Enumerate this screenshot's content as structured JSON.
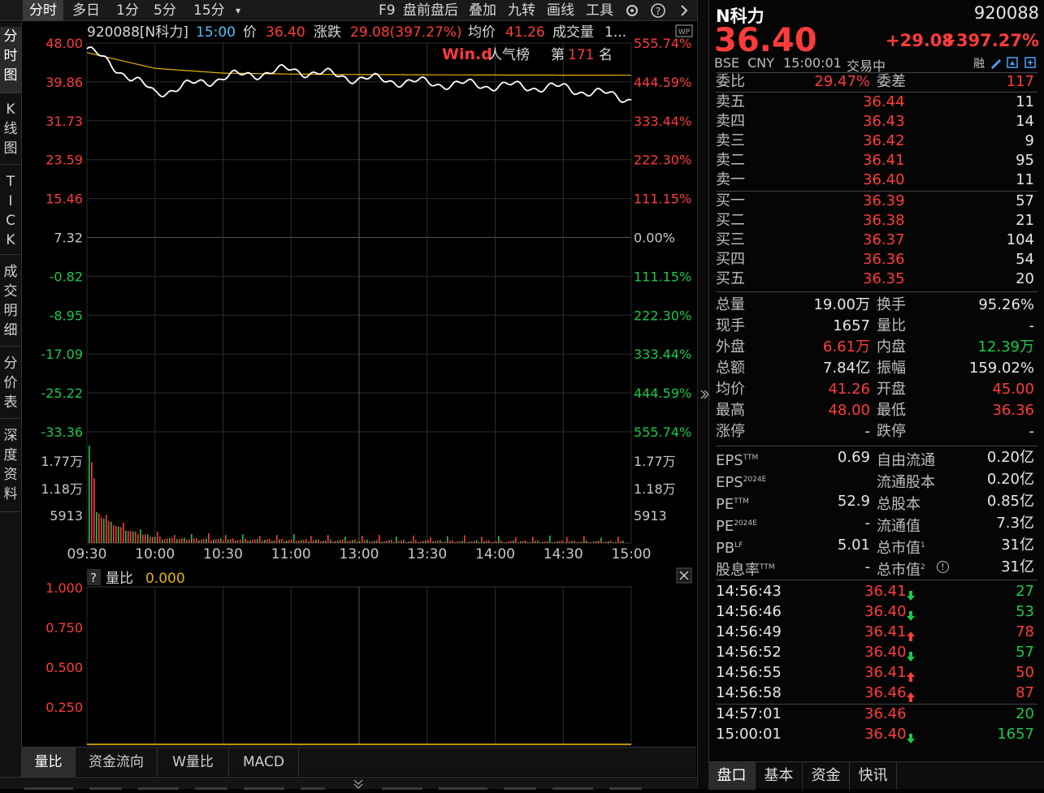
{
  "toolbar": {
    "tabs": [
      "分时",
      "多日",
      "1分",
      "5分",
      "15分"
    ],
    "dropdown": "▾",
    "actions": [
      "F9",
      "盘前盘后",
      "叠加",
      "九转",
      "画线",
      "工具"
    ]
  },
  "left_tabs": [
    {
      "label": "分\n时\n图"
    },
    {
      "label": "K\n线\n图"
    },
    {
      "label": "T\nI\nC\nK"
    },
    {
      "label": "成\n交\n明\n细"
    },
    {
      "label": "分\n价\n表"
    },
    {
      "label": "深\n度\n资\n料"
    }
  ],
  "chart_header": {
    "code_name": "920088[N科力]",
    "time": "15:00",
    "price_label": "价",
    "price": "36.40",
    "change_label": "涨跌",
    "change": "29.08(397.27%)",
    "avg_label": "均价",
    "avg": "41.26",
    "vol_label": "成交量",
    "vol": "1...",
    "wp_badge": "WP"
  },
  "popularity": {
    "logo": "Win.d",
    "label": "人气榜",
    "rank_prefix": "第",
    "rank": "171",
    "rank_suffix": "名"
  },
  "price_axis": {
    "left": [
      "48.00",
      "39.86",
      "31.73",
      "23.59",
      "15.46",
      "7.32",
      "-0.82",
      "-8.95",
      "-17.09",
      "-25.22",
      "-33.36"
    ],
    "right": [
      "555.74%",
      "444.59%",
      "333.44%",
      "222.30%",
      "111.15%",
      "0.00%",
      "111.15%",
      "222.30%",
      "333.44%",
      "444.59%",
      "555.74%"
    ]
  },
  "volume_axis": {
    "left": [
      "1.77万",
      "1.18万",
      "5913"
    ],
    "right": [
      "1.77万",
      "1.18万",
      "5913"
    ]
  },
  "time_axis": [
    "09:30",
    "10:00",
    "10:30",
    "11:00",
    "13:00",
    "13:30",
    "14:00",
    "14:30",
    "15:00"
  ],
  "indicator": {
    "help": "?",
    "name": "量比",
    "value": "0.000",
    "axis": [
      "1.000",
      "0.750",
      "0.500",
      "0.250"
    ]
  },
  "bottom_tabs": [
    "量比",
    "资金流向",
    "W量比",
    "MACD"
  ],
  "chart_data": {
    "type": "line",
    "title": "",
    "x": [
      "09:30",
      "10:00",
      "10:30",
      "11:00",
      "13:00",
      "13:30",
      "14:00",
      "14:30",
      "15:00"
    ],
    "ylim": [
      -33.36,
      48.0
    ],
    "series": [
      {
        "name": "价",
        "values": [
          46.8,
          37.5,
          40.8,
          42.4,
          40.6,
          39.6,
          39.1,
          38.6,
          36.4
        ]
      },
      {
        "name": "均价",
        "values": [
          46.0,
          42.7,
          41.7,
          41.5,
          41.4,
          41.35,
          41.3,
          41.28,
          41.26
        ]
      }
    ]
  },
  "quote": {
    "name": "N科力",
    "code": "920088",
    "price": "36.40",
    "change": "+29.08",
    "change_pct": "+397.27%",
    "exchange": "BSE",
    "currency": "CNY",
    "time": "15:00:01",
    "status": "交易中",
    "rong": "融"
  },
  "order_book": {
    "ratio_label": "委比",
    "ratio": "29.47%",
    "diff_label": "委差",
    "diff": "117",
    "asks": [
      {
        "label": "卖五",
        "price": "36.44",
        "vol": "11"
      },
      {
        "label": "卖四",
        "price": "36.43",
        "vol": "14"
      },
      {
        "label": "卖三",
        "price": "36.42",
        "vol": "9"
      },
      {
        "label": "卖二",
        "price": "36.41",
        "vol": "95"
      },
      {
        "label": "卖一",
        "price": "36.40",
        "vol": "11"
      }
    ],
    "bids": [
      {
        "label": "买一",
        "price": "36.39",
        "vol": "57"
      },
      {
        "label": "买二",
        "price": "36.38",
        "vol": "21"
      },
      {
        "label": "买三",
        "price": "36.37",
        "vol": "104"
      },
      {
        "label": "买四",
        "price": "36.36",
        "vol": "54"
      },
      {
        "label": "买五",
        "price": "36.35",
        "vol": "20"
      }
    ]
  },
  "stats": [
    {
      "l1": "总量",
      "v1": "19.00万",
      "c1": "white",
      "l2": "换手",
      "v2": "95.26%",
      "c2": "white"
    },
    {
      "l1": "现手",
      "v1": "1657",
      "c1": "white",
      "l2": "量比",
      "v2": "-",
      "c2": "white"
    },
    {
      "l1": "外盘",
      "v1": "6.61万",
      "c1": "red",
      "l2": "内盘",
      "v2": "12.39万",
      "c2": "green"
    },
    {
      "l1": "总额",
      "v1": "7.84亿",
      "c1": "white",
      "l2": "振幅",
      "v2": "159.02%",
      "c2": "white"
    },
    {
      "l1": "均价",
      "v1": "41.26",
      "c1": "red",
      "l2": "开盘",
      "v2": "45.00",
      "c2": "red"
    },
    {
      "l1": "最高",
      "v1": "48.00",
      "c1": "red",
      "l2": "最低",
      "v2": "36.36",
      "c2": "red"
    },
    {
      "l1": "涨停",
      "v1": "-",
      "c1": "white",
      "l2": "跌停",
      "v2": "-",
      "c2": "white"
    }
  ],
  "fundamentals": [
    {
      "l1": "EPS",
      "s1": "TTM",
      "v1": "0.69",
      "l2": "自由流通",
      "s2": "",
      "v2": "0.20亿"
    },
    {
      "l1": "EPS",
      "s1": "2024E",
      "v1": "",
      "l2": "流通股本",
      "s2": "",
      "v2": "0.20亿"
    },
    {
      "l1": "PE",
      "s1": "TTM",
      "v1": "52.9",
      "l2": "总股本",
      "s2": "",
      "v2": "0.85亿"
    },
    {
      "l1": "PE",
      "s1": "2024E",
      "v1": "-",
      "l2": "流通值",
      "s2": "",
      "v2": "7.3亿"
    },
    {
      "l1": "PB",
      "s1": "LF",
      "v1": "5.01",
      "l2": "总市值",
      "s2": "1",
      "v2": "31亿"
    },
    {
      "l1": "股息率",
      "s1": "TTM",
      "v1": "-",
      "l2": "总市值",
      "s2": "2",
      "v2": "31亿"
    }
  ],
  "trades": [
    {
      "time": "14:56:43",
      "price": "36.41",
      "dir": "down",
      "vol": "27",
      "vcolor": "green"
    },
    {
      "time": "14:56:46",
      "price": "36.40",
      "dir": "down",
      "vol": "53",
      "vcolor": "green"
    },
    {
      "time": "14:56:49",
      "price": "36.41",
      "dir": "up",
      "vol": "78",
      "vcolor": "red"
    },
    {
      "time": "14:56:52",
      "price": "36.40",
      "dir": "down",
      "vol": "57",
      "vcolor": "green"
    },
    {
      "time": "14:56:55",
      "price": "36.41",
      "dir": "up",
      "vol": "50",
      "vcolor": "red"
    },
    {
      "time": "14:56:58",
      "price": "36.46",
      "dir": "up",
      "vol": "87",
      "vcolor": "red"
    },
    {
      "time": "14:57:01",
      "price": "36.46",
      "dir": "",
      "vol": "20",
      "vcolor": "green"
    },
    {
      "time": "15:00:01",
      "price": "36.40",
      "dir": "down",
      "vol": "1657",
      "vcolor": "green"
    }
  ],
  "right_tabs": [
    "盘口",
    "基本",
    "资金",
    "快讯"
  ],
  "colors": {
    "up": "#ff3b3b",
    "down": "#19c94a",
    "price_line": "#ffffff",
    "avg_line": "#e8b400",
    "grid": "#3a3a3a"
  }
}
